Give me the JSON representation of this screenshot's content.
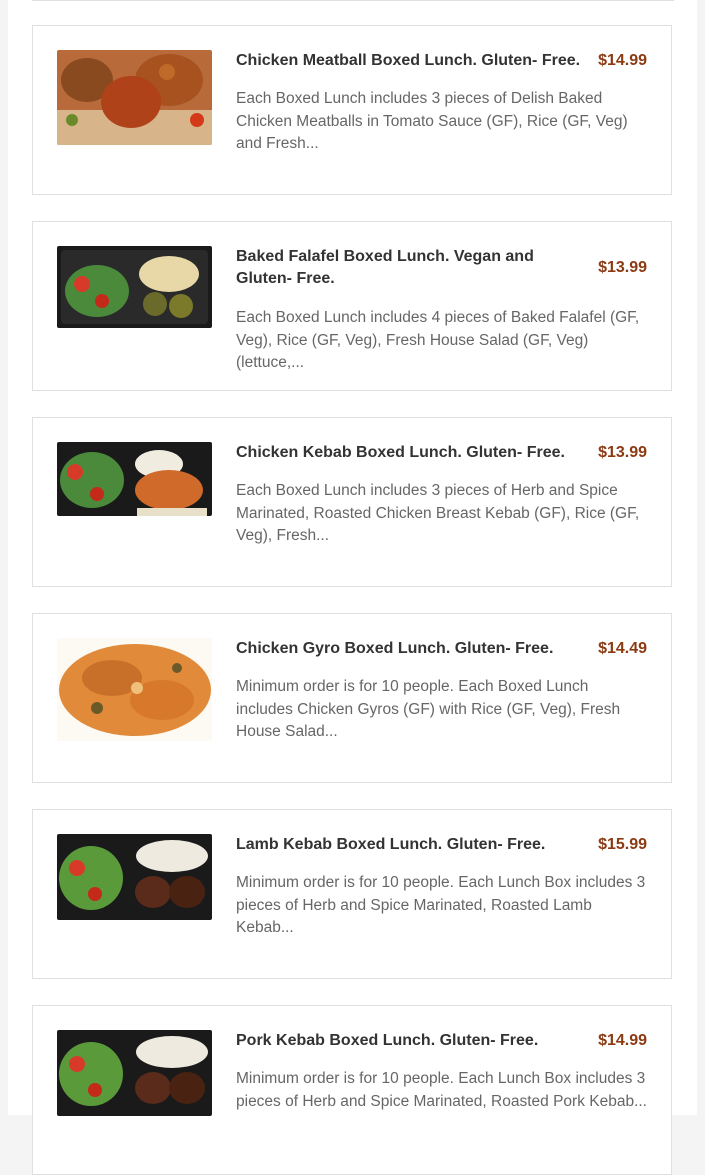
{
  "menu": {
    "items": [
      {
        "title": "Chicken Meatball Boxed Lunch. Gluten- Free.",
        "price": "$14.99",
        "description": "Each Boxed Lunch includes 3 pieces of Delish Baked Chicken Meatballs in Tomato Sauce (GF), Rice (GF, Veg) and Fresh..."
      },
      {
        "title": "Baked Falafel Boxed Lunch. Vegan and Gluten- Free.",
        "price": "$13.99",
        "description": "Each Boxed Lunch includes 4 pieces of Baked Falafel (GF, Veg), Rice (GF, Veg), Fresh House Salad (GF, Veg) (lettuce,..."
      },
      {
        "title": "Chicken Kebab Boxed Lunch. Gluten- Free.",
        "price": "$13.99",
        "description": "Each Boxed Lunch includes 3 pieces of Herb and  Spice Marinated, Roasted Chicken Breast Kebab (GF), Rice (GF, Veg), Fresh..."
      },
      {
        "title": "Chicken Gyro Boxed Lunch. Gluten- Free.",
        "price": "$14.49",
        "description": "Minimum order is for 10 people.  Each Boxed Lunch includes Chicken Gyros (GF) with Rice (GF, Veg), Fresh House Salad..."
      },
      {
        "title": "Lamb Kebab Boxed Lunch. Gluten- Free.",
        "price": "$15.99",
        "description": "Minimum order is for 10 people.  Each Lunch Box includes 3 pieces of Herb and  Spice Marinated, Roasted Lamb Kebab..."
      },
      {
        "title": "Pork Kebab Boxed Lunch. Gluten- Free.",
        "price": "$14.99",
        "description": "Minimum order is for 10 people. Each Lunch Box includes 3 pieces of Herb and  Spice Marinated, Roasted Pork Kebab..."
      }
    ]
  },
  "colors": {
    "price": "#8b3a12",
    "border": "#e0e0e0",
    "title": "#333333",
    "description": "#666666"
  }
}
